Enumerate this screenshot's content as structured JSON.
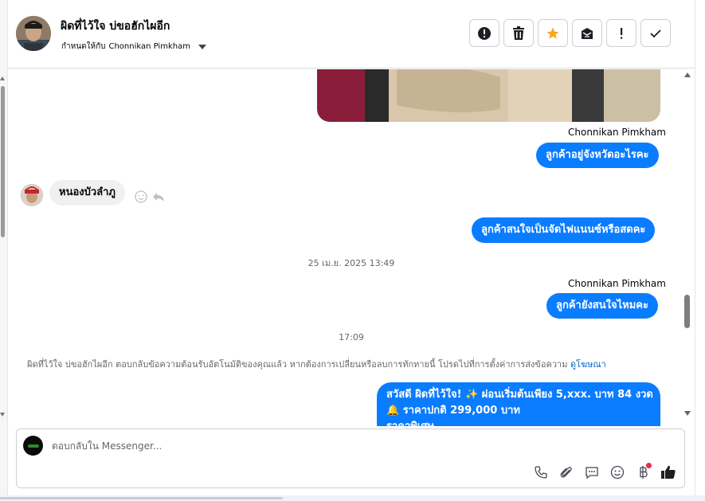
{
  "header": {
    "title": "ผิดที่ไว้ใจ บ่ขอฮักไผอีก",
    "assign_label": "กำหนดให้กับ",
    "assignee": "Chonnikan Pimkham"
  },
  "actions": [
    {
      "name": "report",
      "icon": "exclamation-circle-icon"
    },
    {
      "name": "delete",
      "icon": "trash-icon"
    },
    {
      "name": "star",
      "icon": "star-icon",
      "color": "#f5a623"
    },
    {
      "name": "mark-spam",
      "icon": "envelope-x-icon"
    },
    {
      "name": "follow-up",
      "icon": "exclamation-icon"
    },
    {
      "name": "done",
      "icon": "checkmark-icon"
    }
  ],
  "messages": {
    "sender_1": "Chonnikan Pimkham",
    "out_1": "ลูกค้าอยู่จังหวัดอะไรคะ",
    "in_1": "หนองบัวลำภู",
    "out_2": "ลูกค้าสนใจเป็นจัดไฟแนนซ์หรือสดคะ",
    "timestamp_1": "25 เม.ย. 2025 13:49",
    "sender_2": "Chonnikan Pimkham",
    "out_3": "ลูกค้ายังสนใจไหมคะ",
    "timestamp_2": "17:09",
    "system_note": "ผิดที่ไว้ใจ บ่ขอฮักไผอีก ตอบกลับข้อความต้อนรับอัตโนมัติของคุณแล้ว หากต้องการเปลี่ยนหรือลบการทักทายนี้ โปรดไปที่การตั้งค่าการส่งข้อความ",
    "system_link": "ดูโฆษณา",
    "welcome_line_1": "สวัสดี ผิดที่ไว้ใจ! ✨  ผ่อนเริ่มต้นเพียง 5,xxx. บาท 84 งวด",
    "welcome_line_2": "🔔 ราคาปกติ 299,000 บาท",
    "welcome_line_3": "ราคาพิเศษ..."
  },
  "composer": {
    "placeholder": "ตอบกลับใน Messenger...",
    "tools": [
      "phone-icon",
      "paperclip-icon",
      "saved-reply-icon",
      "emoji-icon",
      "baht-icon",
      "thumbs-up-icon"
    ]
  },
  "colors": {
    "bubble_out": "#0a7cff",
    "bubble_in": "#f0f0f0",
    "link": "#0064d1",
    "star": "#f5a623"
  }
}
